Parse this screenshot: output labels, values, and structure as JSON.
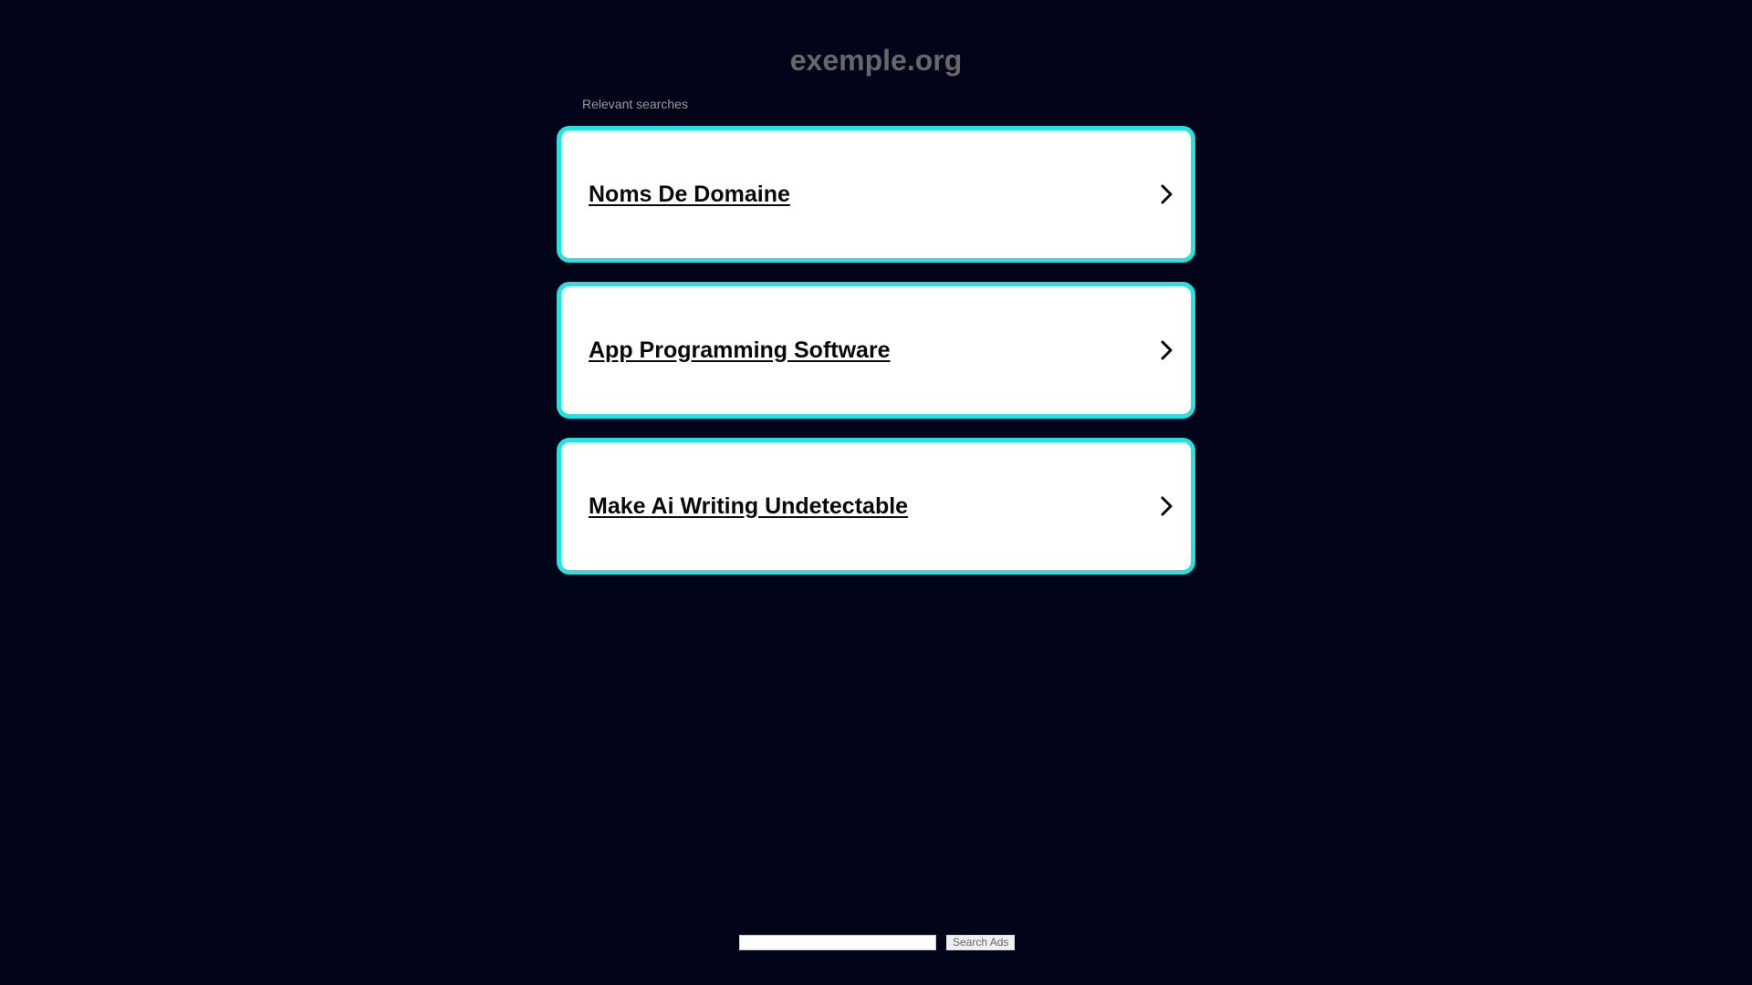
{
  "header": {
    "domain": "exemple.org",
    "subtitle": "Relevant searches"
  },
  "searches": [
    {
      "label": "Noms De Domaine",
      "icon": "chevron-right-icon"
    },
    {
      "label": "App Programming Software",
      "icon": "chevron-right-icon"
    },
    {
      "label": "Make Ai Writing Undetectable",
      "icon": "chevron-right-icon"
    }
  ],
  "footer": {
    "search_input_value": "",
    "search_button_label": "Search Ads"
  },
  "colors": {
    "background": "#02051a",
    "card_border": "#22e2e2",
    "card_background": "#ffffff",
    "title_text": "#676767"
  }
}
